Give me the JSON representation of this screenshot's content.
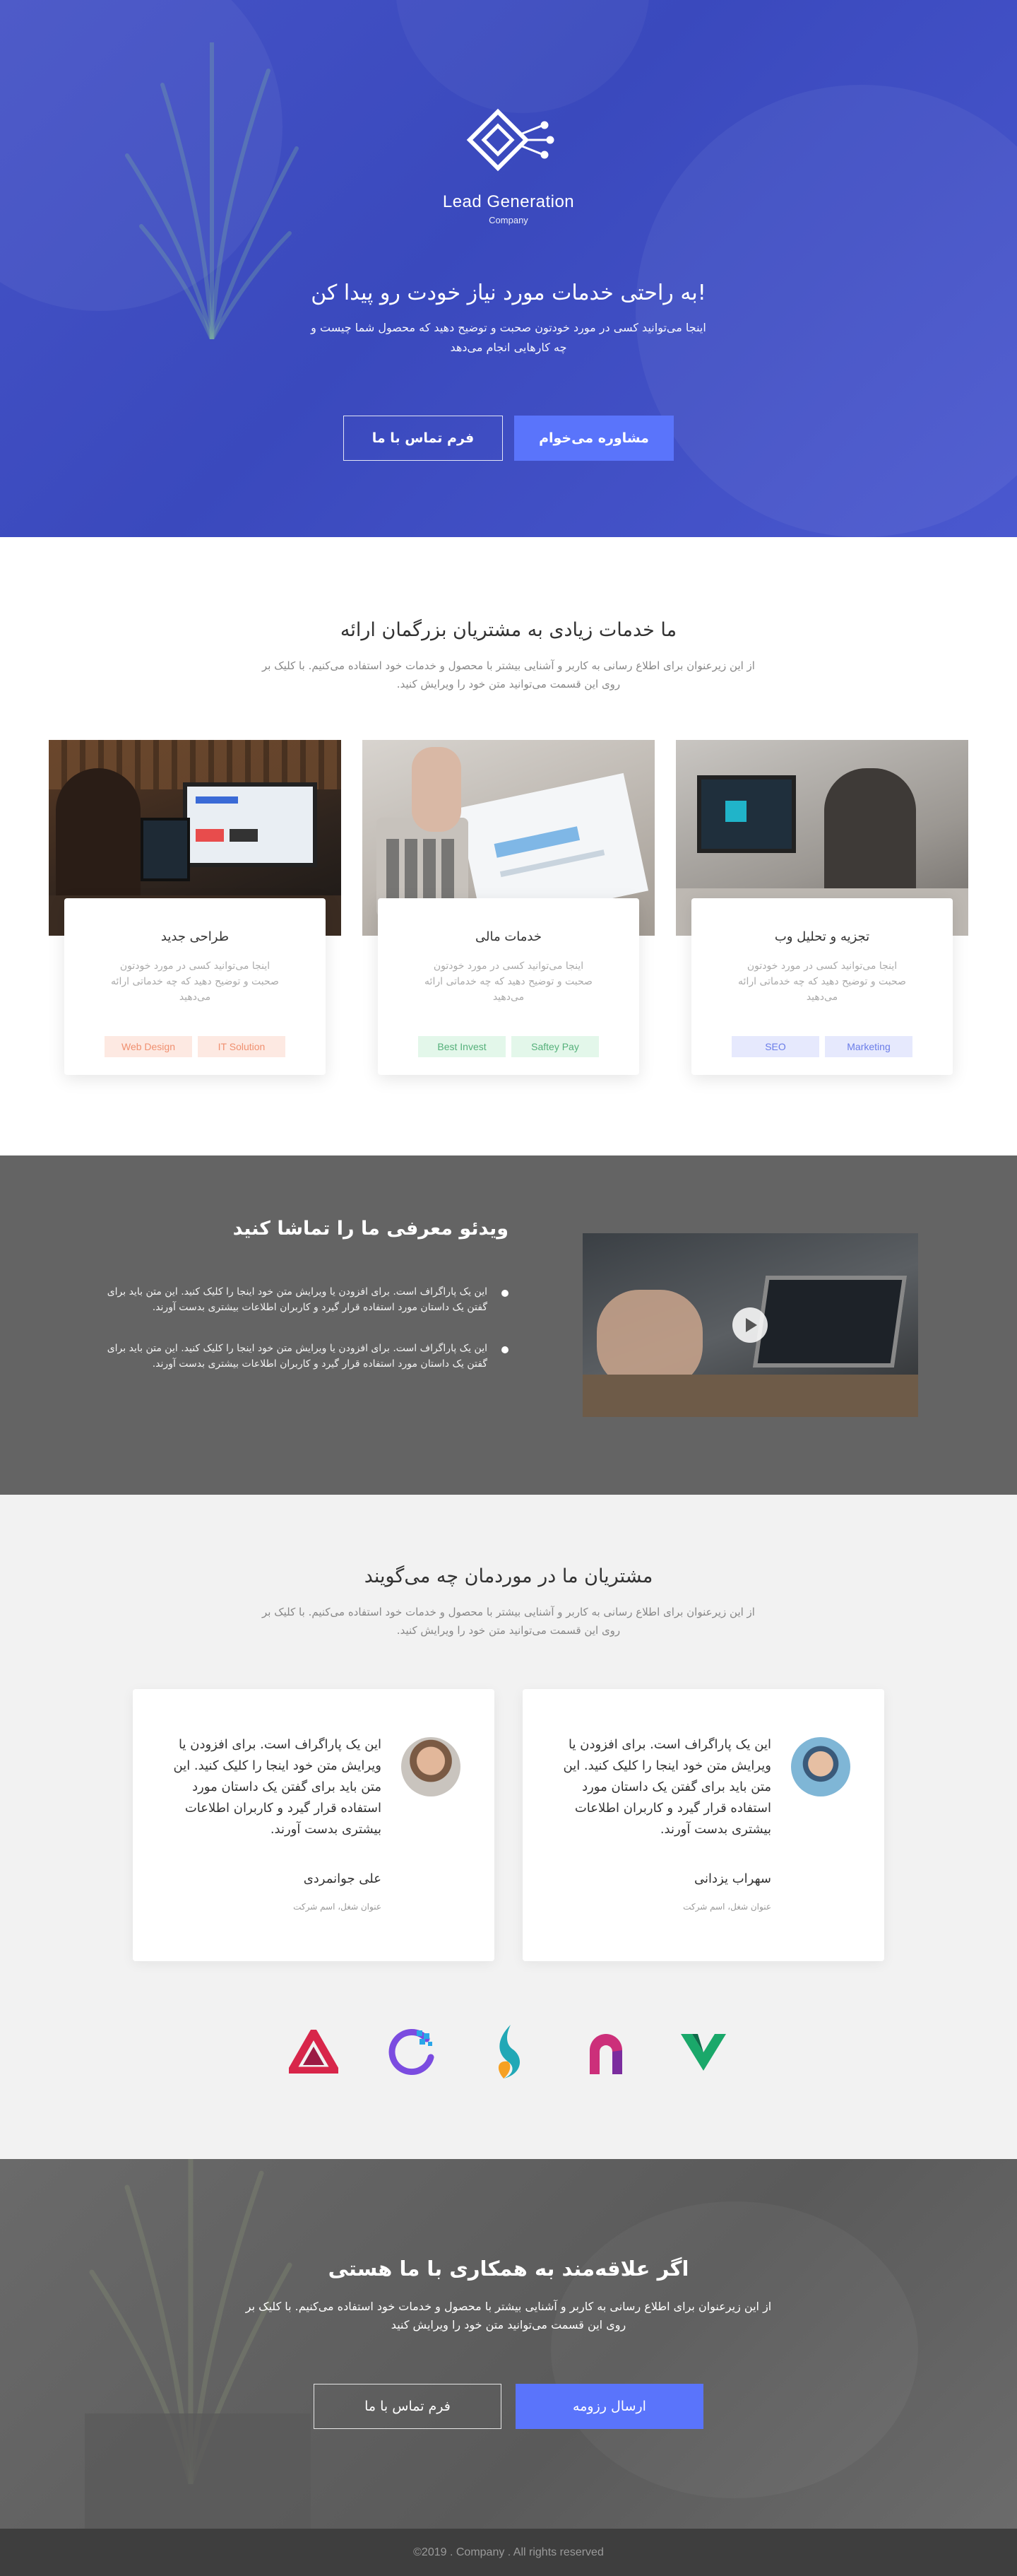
{
  "hero": {
    "logo_title": "Lead Generation",
    "logo_subtitle": "Company",
    "title": "!به راحتی خدمات مورد نیاز خودت رو پیدا کن",
    "text": "اینجا می‌توانید کسی در مورد خودتون صحبت و توضیح دهید که محصول شما چیست و چه کارهایی انجام می‌دهد",
    "btn_contact": "فرم تماس با ما",
    "btn_consult": "مشاوره می‌خوام",
    "colors": {
      "overlay": "#4553c6",
      "accent": "#5a74fb"
    }
  },
  "services": {
    "title": "ما خدمات زیادی به مشتریان بزرگمان ارائه",
    "subtitle": "از این زیرعنوان برای اطلاع رسانی به کاربر و آشنایی بیشتر با محصول و خدمات خود استفاده می‌کنیم. با کلیک بر روی این قسمت می‌توانید متن خود را ویرایش کنید.",
    "cards": [
      {
        "title": "طراحی جدید",
        "text": "اینجا می‌توانید کسی در مورد خودتون صحبت و توضیح دهید که چه خدماتی ارائه می‌دهید",
        "tags": [
          "Web Design",
          "IT Solution"
        ],
        "tag_color": "#fde9e2"
      },
      {
        "title": "خدمات مالی",
        "text": "اینجا می‌توانید کسی در مورد خودتون صحبت و توضیح دهید که چه خدماتی ارائه می‌دهید",
        "tags": [
          "Best Invest",
          "Saftey Pay"
        ],
        "tag_color": "#e3f7ea"
      },
      {
        "title": "تجزیه و تحلیل وب",
        "text": "اینجا می‌توانید کسی در مورد خودتون صحبت و توضیح دهید که چه خدماتی ارائه می‌دهید",
        "tags": [
          "SEO",
          "Marketing"
        ],
        "tag_color": "#e6e9fd"
      }
    ]
  },
  "video": {
    "title": "ویدئو معرفی ما را تماشا کنید",
    "items": [
      "این یک پاراگراف است. برای افزودن یا ویرایش متن خود اینجا را کلیک کنید. این متن باید  برای گفتن یک داستان مورد استفاده قرار گیرد و کاربران اطلاعات بیشتری بدست آورند.",
      "این یک پاراگراف است. برای افزودن یا ویرایش متن خود اینجا را کلیک کنید. این متن باید  برای گفتن یک داستان مورد استفاده قرار گیرد و کاربران اطلاعات بیشتری بدست آورند."
    ]
  },
  "testimonials": {
    "title": "مشتریان ما در موردمان چه می‌گویند",
    "subtitle": "از این زیرعنوان برای اطلاع رسانی به کاربر و آشنایی بیشتر با محصول و خدمات خود استفاده می‌کنیم. با کلیک بر روی این قسمت می‌توانید متن خود را ویرایش کنید.",
    "items": [
      {
        "quote": "این یک پاراگراف است. برای افزودن یا ویرایش متن خود اینجا را کلیک کنید. این متن باید  برای گفتن یک داستان مورد استفاده قرار گیرد و کاربران اطلاعات بیشتری بدست آورند.",
        "name": "علی جوانمردی",
        "role": "عنوان شغل، اسم شرکت"
      },
      {
        "quote": "این یک پاراگراف است. برای افزودن یا ویرایش متن خود اینجا را کلیک کنید. این متن باید  برای گفتن یک داستان مورد استفاده قرار گیرد و کاربران اطلاعات بیشتری بدست آورند.",
        "name": "سهراب یزدانی",
        "role": "عنوان شغل، اسم شرکت"
      }
    ],
    "logos": [
      "triangle-logo-icon",
      "circle-dots-logo-icon",
      "flame-leaf-logo-icon",
      "arch-logo-icon",
      "v-shape-logo-icon"
    ]
  },
  "cta": {
    "title": "اگر علاقه‌مند به همکاری با ما هستی",
    "text": "از این زیرعنوان برای اطلاع رسانی به کاربر و آشنایی بیشتر با محصول و خدمات خود استفاده می‌کنیم. با کلیک بر روی این قسمت می‌توانید متن خود را ویرایش کنید",
    "btn_contact": "فرم تماس با ما",
    "btn_resume": "ارسال رزومه"
  },
  "footer": {
    "text": "©2019 . Company . All rights reserved"
  }
}
